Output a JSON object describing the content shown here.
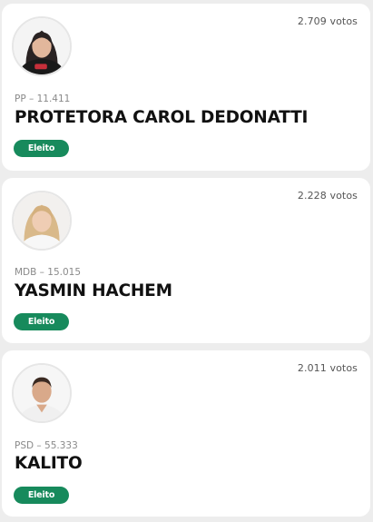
{
  "candidates": [
    {
      "votes": "2.709 votos",
      "party": "PP – 11.411",
      "name": "PROTETORA CAROL DEDONATTI",
      "status": "Eleito",
      "avatar_icon": "candidate-photo-woman-dark-hair"
    },
    {
      "votes": "2.228 votos",
      "party": "MDB – 15.015",
      "name": "YASMIN HACHEM",
      "status": "Eleito",
      "avatar_icon": "candidate-photo-woman-blonde-hair"
    },
    {
      "votes": "2.011 votos",
      "party": "PSD – 55.333",
      "name": "KALITO",
      "status": "Eleito",
      "avatar_icon": "candidate-photo-man-short-hair"
    }
  ],
  "colors": {
    "badge": "#178a5c",
    "background": "#ededed",
    "card": "#ffffff"
  }
}
